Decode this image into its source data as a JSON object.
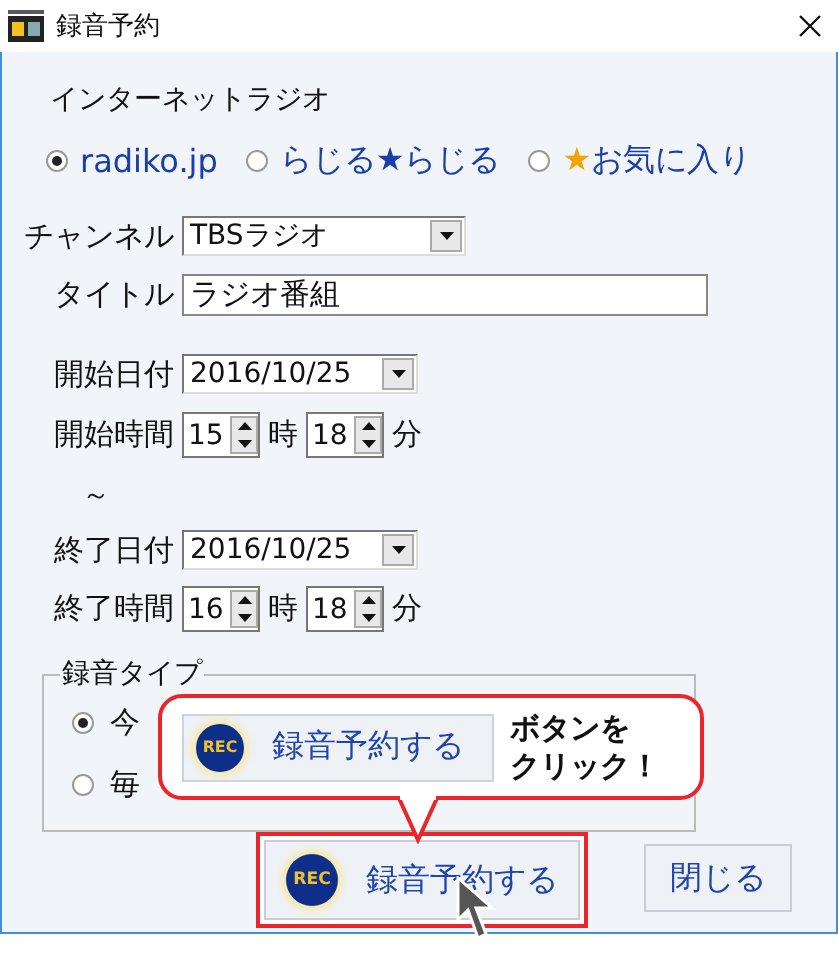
{
  "window": {
    "title": "録音予約"
  },
  "source_group": {
    "label": "インターネットラジオ",
    "options": [
      {
        "label": "radiko.jp",
        "selected": true
      },
      {
        "label": "らじる★らじる",
        "selected": false
      },
      {
        "marker": "★",
        "label": "お気に入り",
        "selected": false
      }
    ]
  },
  "channel": {
    "label": "チャンネル",
    "value": "TBSラジオ"
  },
  "title_field": {
    "label": "タイトル",
    "value": "ラジオ番組"
  },
  "start_date": {
    "label": "開始日付",
    "value": "2016/10/25"
  },
  "start_time": {
    "label": "開始時間",
    "hour": "15",
    "hour_unit": "時",
    "minute": "18",
    "minute_unit": "分"
  },
  "separator": "～",
  "end_date": {
    "label": "終了日付",
    "value": "2016/10/25"
  },
  "end_time": {
    "label": "終了時間",
    "hour": "16",
    "hour_unit": "時",
    "minute": "18",
    "minute_unit": "分"
  },
  "recording_type": {
    "label": "録音タイプ",
    "options": [
      {
        "label": "今",
        "selected": true
      },
      {
        "label": "毎",
        "selected": false
      }
    ]
  },
  "buttons": [
    {
      "kind": "record",
      "label": "録音予約する",
      "icon_text": "REC",
      "highlighted": true
    },
    {
      "kind": "close",
      "label": "閉じる",
      "highlighted": false
    }
  ],
  "callout": {
    "button_label": "録音予約する",
    "icon_text": "REC",
    "lines": [
      "ボタンを",
      "クリック！"
    ]
  }
}
